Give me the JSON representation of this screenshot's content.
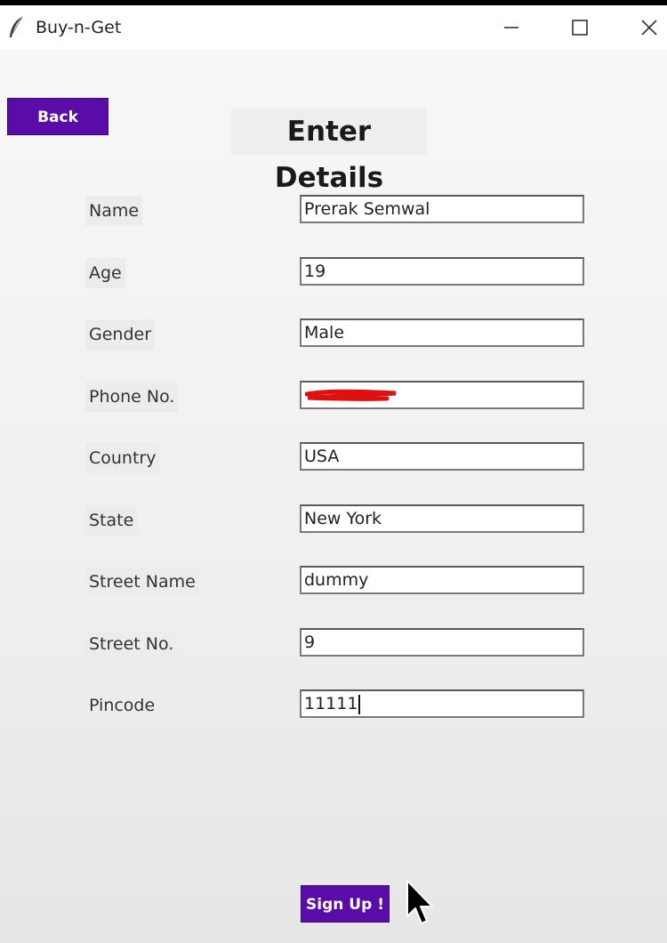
{
  "window": {
    "title": "Buy-n-Get",
    "controls": [
      "minimize",
      "maximize",
      "close"
    ]
  },
  "back_button": {
    "label": "Back"
  },
  "form": {
    "title": "Enter Details",
    "fields": [
      {
        "label": "Name",
        "value": "Prerak Semwal"
      },
      {
        "label": "Age",
        "value": "19"
      },
      {
        "label": "Gender",
        "value": "Male"
      },
      {
        "label": "Phone No.",
        "value": ""
      },
      {
        "label": "Country",
        "value": "USA"
      },
      {
        "label": "State",
        "value": "New York"
      },
      {
        "label": "Street Name",
        "value": "dummy"
      },
      {
        "label": "Street No.",
        "value": "9"
      },
      {
        "label": "Pincode",
        "value": "11111"
      }
    ]
  },
  "signup_button": {
    "label": "Sign Up !"
  },
  "colors": {
    "accent": "#5a0ca8",
    "redaction": "#e01010"
  },
  "icons": {
    "app": "feather-icon",
    "minimize": "minimize-icon",
    "maximize": "maximize-icon",
    "close": "close-icon",
    "pointer": "mouse-pointer-icon"
  }
}
